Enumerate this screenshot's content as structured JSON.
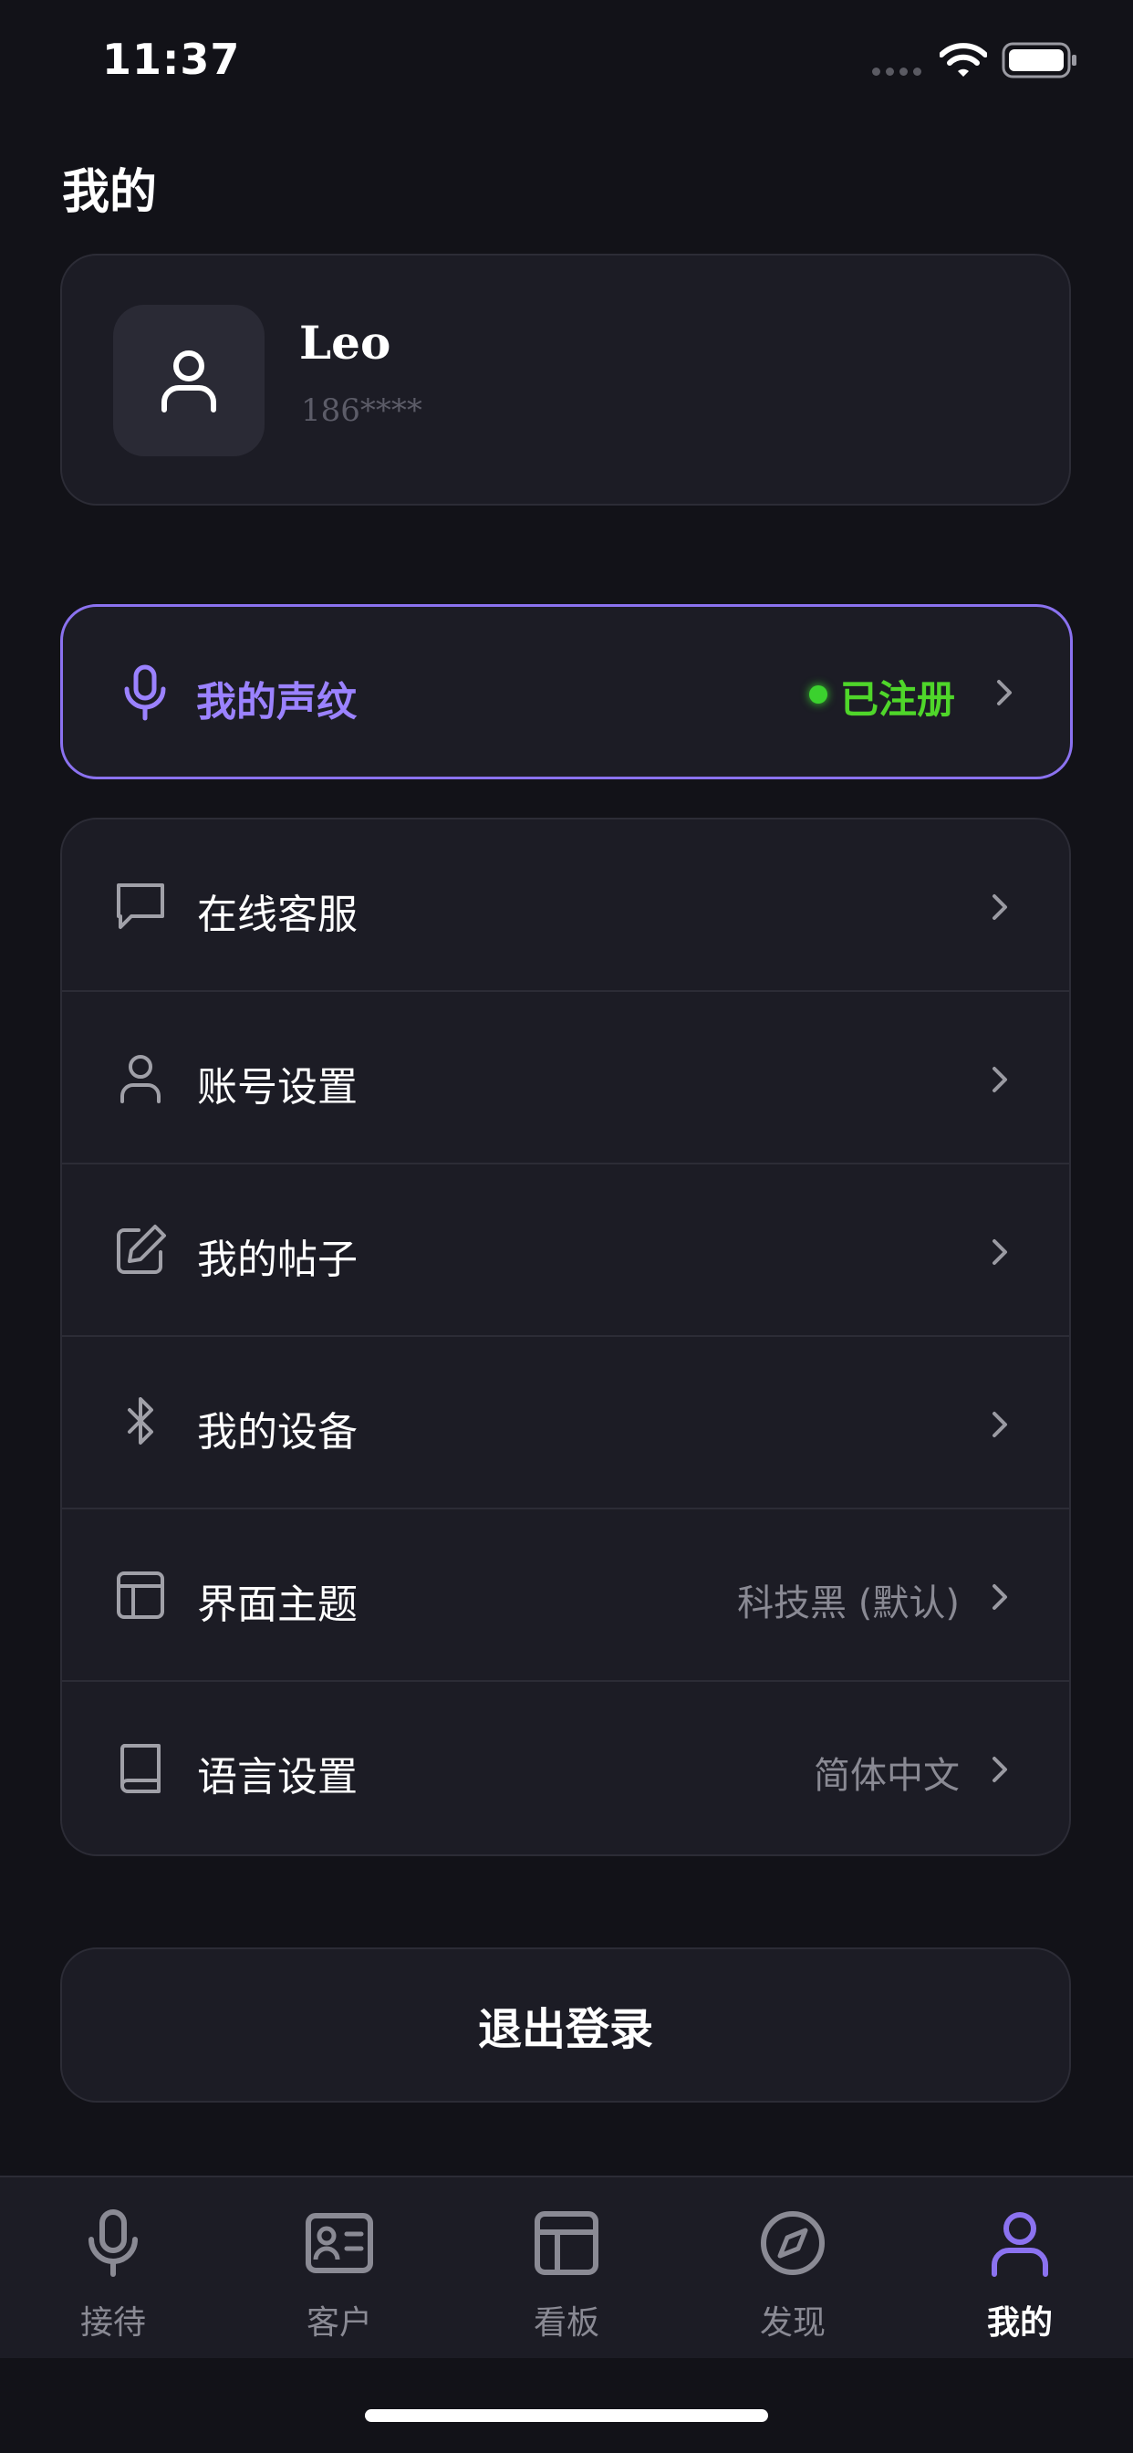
{
  "status_bar": {
    "time": "11:37"
  },
  "page": {
    "title": "我的"
  },
  "profile": {
    "name": "Leo",
    "phone": "186****",
    "avatar_icon": "user-icon"
  },
  "voiceprint": {
    "label": "我的声纹",
    "status": "已注册",
    "icon": "microphone-icon",
    "accent_color": "#8b72f0",
    "status_color": "#4fd62a"
  },
  "menu": {
    "items": [
      {
        "label": "在线客服",
        "value": "",
        "icon": "chat-bubble-icon"
      },
      {
        "label": "账号设置",
        "value": "",
        "icon": "user-icon"
      },
      {
        "label": "我的帖子",
        "value": "",
        "icon": "edit-icon"
      },
      {
        "label": "我的设备",
        "value": "",
        "icon": "bluetooth-icon"
      },
      {
        "label": "界面主题",
        "value": "科技黑 (默认)",
        "icon": "layout-icon"
      },
      {
        "label": "语言设置",
        "value": "简体中文",
        "icon": "book-icon"
      }
    ]
  },
  "logout": {
    "label": "退出登录"
  },
  "tab_bar": {
    "tabs": [
      {
        "label": "接待",
        "icon": "microphone-icon",
        "active": false
      },
      {
        "label": "客户",
        "icon": "contact-card-icon",
        "active": false
      },
      {
        "label": "看板",
        "icon": "dashboard-icon",
        "active": false
      },
      {
        "label": "发现",
        "icon": "compass-icon",
        "active": false
      },
      {
        "label": "我的",
        "icon": "user-icon",
        "active": true
      }
    ],
    "active_color": "#8b72f0"
  }
}
